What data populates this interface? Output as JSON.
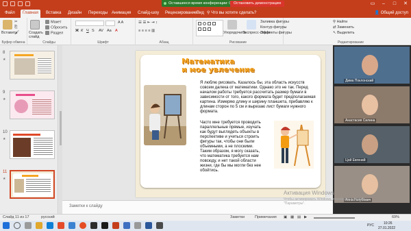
{
  "conference": {
    "remaining": "Оставшееся время конференции: 05:37",
    "stop_demo": "Остановить демонстрацию"
  },
  "tabs": [
    "Файл",
    "Главная",
    "Вставка",
    "Дизайн",
    "Переходы",
    "Анимация",
    "Слайд-шоу",
    "Рецензирование",
    "Вид"
  ],
  "search_tell": "Что вы хотите сделать?",
  "share": "Общий доступ",
  "ribbon": {
    "clipboard": {
      "paste": "Вставить",
      "cut": "Вырезать",
      "copy": "Копировать",
      "format": "Формат",
      "label": "Буфер обмена"
    },
    "slides": {
      "create": "Создать слайд",
      "layout": "Макет",
      "reset": "Сбросить",
      "section": "Раздел",
      "label": "Слайды"
    },
    "font_label": "Шрифт",
    "para_label": "Абзац",
    "drawing": {
      "arrange": "Упорядочить",
      "quick_styles": "Экспресс-стили",
      "fill": "Заливка фигуры",
      "outline": "Контур фигуры",
      "effects": "Эффекты фигуры",
      "label": "Рисование"
    },
    "editing": {
      "find": "Найти",
      "replace": "Заменить",
      "select": "Выделить",
      "label": "Редактирование"
    }
  },
  "thumbnails": [
    {
      "num": "8"
    },
    {
      "num": "9"
    },
    {
      "num": "10"
    },
    {
      "num": "11"
    }
  ],
  "slide": {
    "title_line1": "Математика",
    "title_line2": "и мое увлечение",
    "para1": "Я люблю рисовать. Казалось бы, эта область искусств совсем далека от математики. Однако это не так. Перед началом работы требуется рассчитать размер бумаги в зависимости от того, какого формата будет предполагаемая картина. Измеряю длину и ширину планшета, прибавляю к длинам сторон по 5 см и вырезаю лист бумаги нужного формата.",
    "para2": "Часто мне требуется проводить параллельные прямые, изучать как будут выглядеть объекты в перспективе и учиться строить фигуры так, чтобы они были объемными, а не плоскими. Таким образом, я могу сказать, что математика требуется нам повсюду, и нет такой области жизни, где бы мы могли без нее обойтись."
  },
  "notes_placeholder": "Заметки к слайду",
  "participants": [
    {
      "name": "Дима Поклонский"
    },
    {
      "name": "Анастасия Силина"
    },
    {
      "name": "Цой Евгений"
    },
    {
      "name": "Анна Голубович"
    }
  ],
  "watermark": {
    "line1": "Активация Windows",
    "line2": "Чтобы активировать Windows, перейдите в раздел \"Параметры\"."
  },
  "status": {
    "slide": "Слайд 11 из 17",
    "lang": "русский",
    "notes": "Заметки",
    "comments": "Примечания",
    "zoom": "69%"
  },
  "taskbar": {
    "lang": "РУС",
    "time": "10:26",
    "date": "27.01.2022"
  }
}
